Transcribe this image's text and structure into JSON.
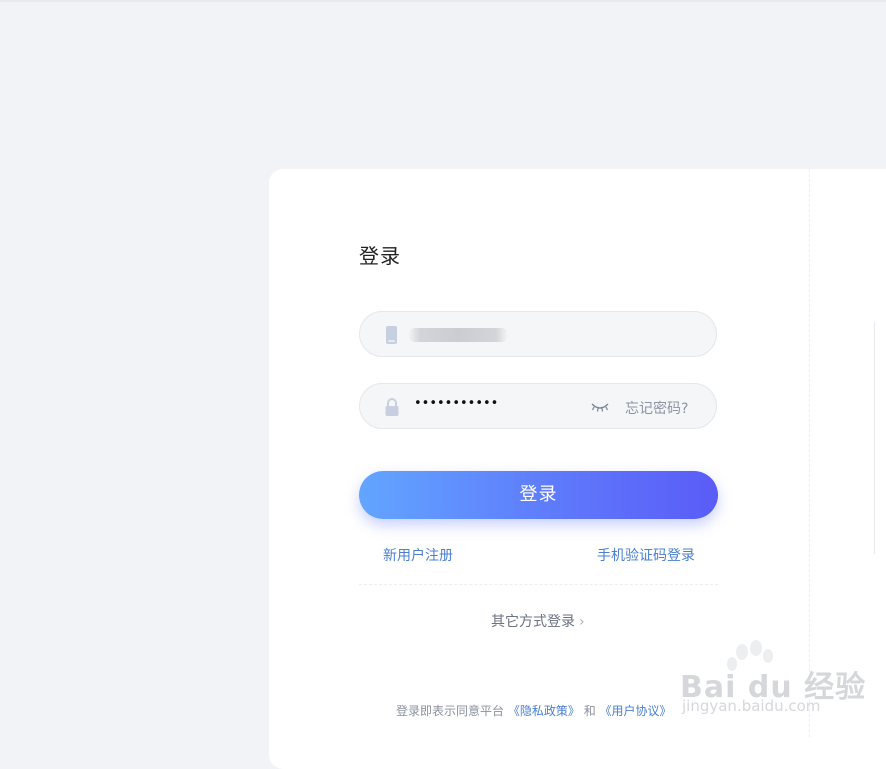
{
  "login": {
    "title": "登录",
    "password_mask": "•••••••••••",
    "forgot_label": "忘记密码?",
    "submit_label": "登录",
    "register_label": "新用户注册",
    "sms_login_label": "手机验证码登录",
    "other_methods_label": "其它方式登录",
    "other_chevron": "›",
    "agreement": {
      "prefix": "登录即表示同意平台",
      "privacy_link": "《隐私政策》",
      "and": "和",
      "terms_link": "《用户协议》"
    }
  },
  "icons": {
    "phone": "phone-icon",
    "lock": "lock-icon",
    "eye": "eye-closed-icon"
  },
  "watermark": {
    "brand": "Bai du 经验",
    "url": "jingyan.baidu.com"
  },
  "colors": {
    "background": "#f2f3f6",
    "card": "#ffffff",
    "button_gradient_start": "#62a5ff",
    "button_gradient_end": "#5a5cf7",
    "link": "#4a7fd0",
    "muted_text": "#8c93a3"
  }
}
